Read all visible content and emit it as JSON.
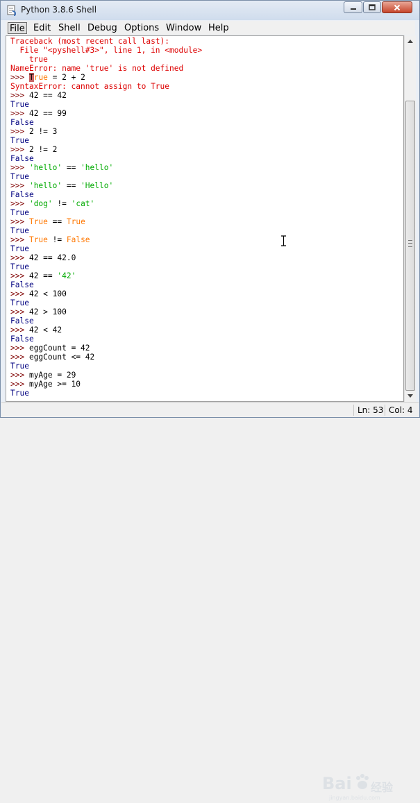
{
  "window": {
    "title": "Python 3.8.6 Shell",
    "controls": [
      "minimize",
      "maximize",
      "close"
    ]
  },
  "menu": {
    "items": [
      "File",
      "Edit",
      "Shell",
      "Debug",
      "Options",
      "Window",
      "Help"
    ]
  },
  "shell_lines": [
    [
      {
        "t": "err",
        "s": "Traceback (most recent call last):"
      }
    ],
    [
      {
        "t": "err",
        "s": "  File \"<pyshell#3>\", line 1, in <module>"
      }
    ],
    [
      {
        "t": "err",
        "s": "    true"
      }
    ],
    [
      {
        "t": "err",
        "s": "NameError: name 'true' is not defined"
      }
    ],
    [
      {
        "t": "prompt",
        "s": ">>> "
      },
      {
        "t": "cursor",
        "s": "T"
      },
      {
        "t": "kw",
        "s": "rue"
      },
      {
        "t": "in",
        "s": " = 2 + 2"
      }
    ],
    [
      {
        "t": "err",
        "s": "SyntaxError: cannot assign to True"
      }
    ],
    [
      {
        "t": "prompt",
        "s": ">>> "
      },
      {
        "t": "in",
        "s": "42 == 42"
      }
    ],
    [
      {
        "t": "out",
        "s": "True"
      }
    ],
    [
      {
        "t": "prompt",
        "s": ">>> "
      },
      {
        "t": "in",
        "s": "42 == 99"
      }
    ],
    [
      {
        "t": "out",
        "s": "False"
      }
    ],
    [
      {
        "t": "prompt",
        "s": ">>> "
      },
      {
        "t": "in",
        "s": "2 != 3"
      }
    ],
    [
      {
        "t": "out",
        "s": "True"
      }
    ],
    [
      {
        "t": "prompt",
        "s": ">>> "
      },
      {
        "t": "in",
        "s": "2 != 2"
      }
    ],
    [
      {
        "t": "out",
        "s": "False"
      }
    ],
    [
      {
        "t": "prompt",
        "s": ">>> "
      },
      {
        "t": "str",
        "s": "'hello'"
      },
      {
        "t": "in",
        "s": " == "
      },
      {
        "t": "str",
        "s": "'hello'"
      }
    ],
    [
      {
        "t": "out",
        "s": "True"
      }
    ],
    [
      {
        "t": "prompt",
        "s": ">>> "
      },
      {
        "t": "str",
        "s": "'hello'"
      },
      {
        "t": "in",
        "s": " == "
      },
      {
        "t": "str",
        "s": "'Hello'"
      }
    ],
    [
      {
        "t": "out",
        "s": "False"
      }
    ],
    [
      {
        "t": "prompt",
        "s": ">>> "
      },
      {
        "t": "str",
        "s": "'dog'"
      },
      {
        "t": "in",
        "s": " != "
      },
      {
        "t": "str",
        "s": "'cat'"
      }
    ],
    [
      {
        "t": "out",
        "s": "True"
      }
    ],
    [
      {
        "t": "prompt",
        "s": ">>> "
      },
      {
        "t": "kw",
        "s": "True"
      },
      {
        "t": "in",
        "s": " == "
      },
      {
        "t": "kw",
        "s": "True"
      }
    ],
    [
      {
        "t": "out",
        "s": "True"
      }
    ],
    [
      {
        "t": "prompt",
        "s": ">>> "
      },
      {
        "t": "kw",
        "s": "True"
      },
      {
        "t": "in",
        "s": " != "
      },
      {
        "t": "kw",
        "s": "False"
      }
    ],
    [
      {
        "t": "out",
        "s": "True"
      }
    ],
    [
      {
        "t": "prompt",
        "s": ">>> "
      },
      {
        "t": "in",
        "s": "42 == 42.0"
      }
    ],
    [
      {
        "t": "out",
        "s": "True"
      }
    ],
    [
      {
        "t": "prompt",
        "s": ">>> "
      },
      {
        "t": "in",
        "s": "42 == "
      },
      {
        "t": "str",
        "s": "'42'"
      }
    ],
    [
      {
        "t": "out",
        "s": "False"
      }
    ],
    [
      {
        "t": "prompt",
        "s": ">>> "
      },
      {
        "t": "in",
        "s": "42 < 100"
      }
    ],
    [
      {
        "t": "out",
        "s": "True"
      }
    ],
    [
      {
        "t": "prompt",
        "s": ">>> "
      },
      {
        "t": "in",
        "s": "42 > 100"
      }
    ],
    [
      {
        "t": "out",
        "s": "False"
      }
    ],
    [
      {
        "t": "prompt",
        "s": ">>> "
      },
      {
        "t": "in",
        "s": "42 < 42"
      }
    ],
    [
      {
        "t": "out",
        "s": "False"
      }
    ],
    [
      {
        "t": "prompt",
        "s": ">>> "
      },
      {
        "t": "in",
        "s": "eggCount = 42"
      }
    ],
    [
      {
        "t": "prompt",
        "s": ">>> "
      },
      {
        "t": "in",
        "s": "eggCount <= 42"
      }
    ],
    [
      {
        "t": "out",
        "s": "True"
      }
    ],
    [
      {
        "t": "prompt",
        "s": ">>> "
      },
      {
        "t": "in",
        "s": "myAge = 29"
      }
    ],
    [
      {
        "t": "prompt",
        "s": ">>> "
      },
      {
        "t": "in",
        "s": "myAge >= 10"
      }
    ],
    [
      {
        "t": "out",
        "s": "True"
      }
    ]
  ],
  "status": {
    "line": "Ln: 53",
    "col": "Col: 4"
  },
  "watermark": {
    "brand": "Bai",
    "brand_sub": "经验",
    "domain": "jingyan.baidu.com"
  },
  "colors": {
    "error": "#dd0000",
    "output": "#000080",
    "prompt": "#7f0000",
    "string": "#00aa00",
    "keyword": "#ff7700"
  }
}
